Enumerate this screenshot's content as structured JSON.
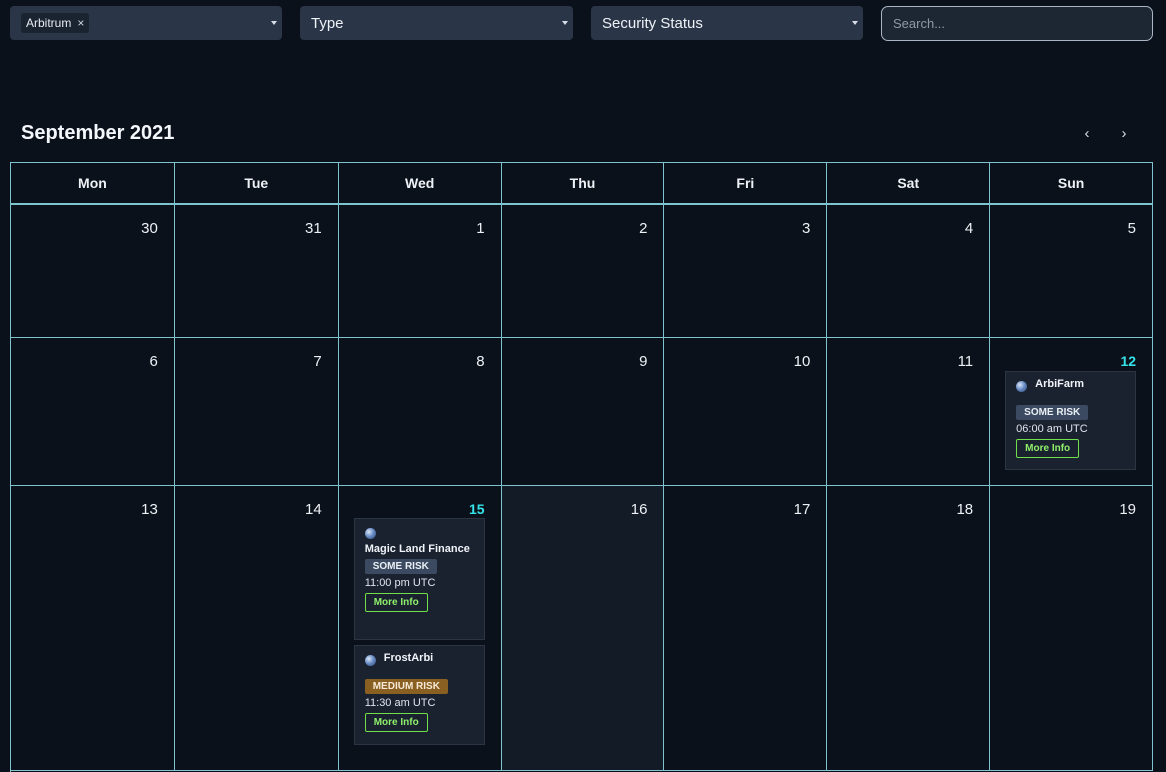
{
  "filters": {
    "network_chip": "Arbitrum",
    "network_chip_remove": "×",
    "type_label": "Type",
    "security_label": "Security Status",
    "search_placeholder": "Search..."
  },
  "calendar": {
    "title": "September 2021",
    "prev_icon": "‹",
    "next_icon": "›",
    "weekdays": [
      "Mon",
      "Tue",
      "Wed",
      "Thu",
      "Fri",
      "Sat",
      "Sun"
    ],
    "weeks": [
      [
        "30",
        "31",
        "1",
        "2",
        "3",
        "4",
        "5"
      ],
      [
        "6",
        "7",
        "8",
        "9",
        "10",
        "11",
        "12"
      ],
      [
        "13",
        "14",
        "15",
        "16",
        "17",
        "18",
        "19"
      ]
    ]
  },
  "events": {
    "arbifarm": {
      "name": "ArbiFarm",
      "risk": "SOME RISK",
      "time": "06:00 am UTC",
      "button": "More Info"
    },
    "magic_land": {
      "name": "Magic Land Finance",
      "risk": "SOME RISK",
      "time": "11:00 pm UTC",
      "button": "More Info"
    },
    "frostarbi": {
      "name": "FrostArbi",
      "risk": "MEDIUM RISK",
      "time": "11:30 am UTC",
      "button": "More Info"
    }
  },
  "colors": {
    "background": "#0b111a",
    "grid_line": "#7fc3cf",
    "today_highlight": "#36e3ea",
    "some_risk": "#3b4a60",
    "medium_risk": "#8a5f22",
    "more_info": "#6fe04a"
  }
}
